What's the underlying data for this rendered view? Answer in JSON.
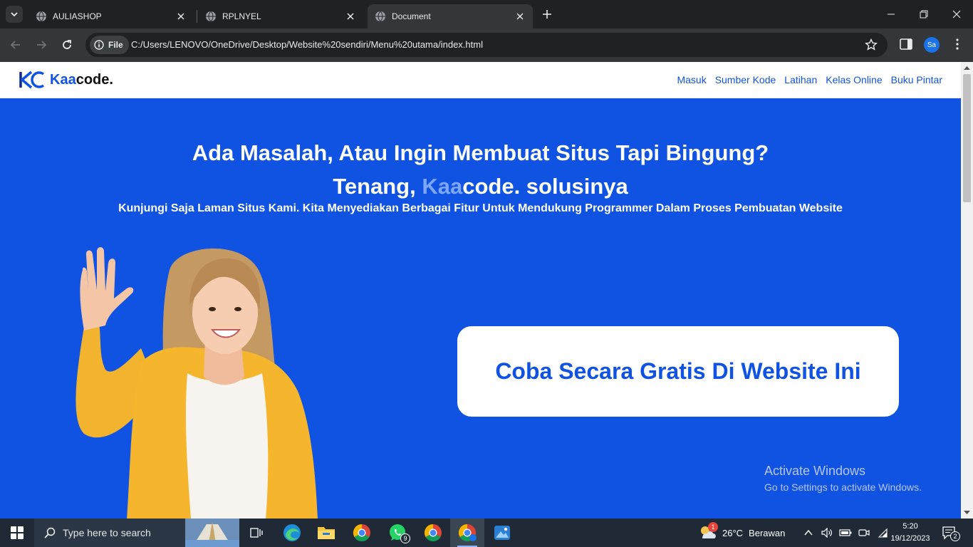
{
  "browser": {
    "tabs": [
      {
        "title": "AULIASHOP",
        "active": false
      },
      {
        "title": "RPLNYEL",
        "active": false
      },
      {
        "title": "Document",
        "active": true
      }
    ],
    "site_chip_label": "File",
    "url": "C:/Users/LENOVO/OneDrive/Desktop/Website%20sendiri/Menu%20utama/index.html",
    "profile_initials": "Sa"
  },
  "site": {
    "logo_mark": "KC",
    "logo_accent": "Kaa",
    "logo_rest": "code.",
    "nav": [
      "Masuk",
      "Sumber Kode",
      "Latihan",
      "Kelas Online",
      "Buku Pintar"
    ],
    "hero": {
      "line1": "Ada Masalah, Atau Ingin Membuat Situs Tapi Bingung?",
      "line2_prefix": "Tenang, ",
      "line2_accent": "Kaa",
      "line2_suffix": "code. solusinya",
      "subtitle": "Kunjungi Saja Laman Situs Kami. Kita Menyediakan Berbagai Fitur Untuk Mendukung Programmer Dalam Proses Pembuatan Website"
    },
    "cta_label": "Coba Secara Gratis Di Website Ini",
    "colors": {
      "primary": "#1053e3",
      "accent_light": "#7ea6ff",
      "white": "#ffffff"
    }
  },
  "watermark": {
    "line1": "Activate Windows",
    "line2": "Go to Settings to activate Windows."
  },
  "taskbar": {
    "search_placeholder": "Type here to search",
    "apps": [
      "task-view",
      "edge",
      "file-explorer",
      "chrome",
      "whatsapp",
      "chrome-profile",
      "chrome-active",
      "photos"
    ],
    "whatsapp_badge": "9",
    "weather_badge": "1",
    "weather_temp": "26°C",
    "weather_text": "Berawan",
    "time": "5:20",
    "date": "19/12/2023",
    "notification_count": "2"
  }
}
